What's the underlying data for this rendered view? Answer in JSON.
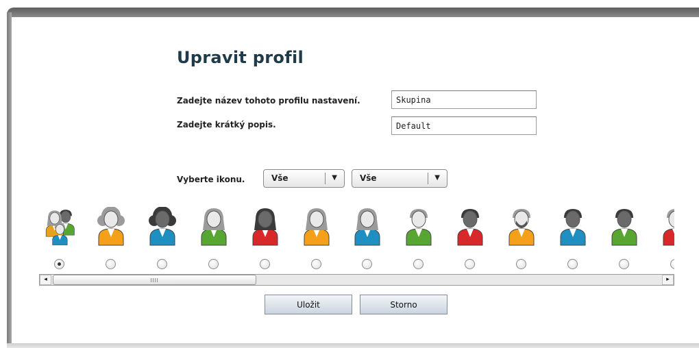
{
  "dialog": {
    "title": "Upravit profil"
  },
  "form": {
    "name_label": "Zadejte název tohoto profilu nastavení.",
    "name_value": "Skupina",
    "description_label": "Zadejte krátký popis.",
    "description_value": "Default"
  },
  "icon_picker": {
    "label": "Vyberte ikonu.",
    "filter1": "Vše",
    "filter2": "Vše",
    "selected_index": 0,
    "icons": [
      {
        "name": "group-icon",
        "type": "group",
        "color": "#e8a31e"
      },
      {
        "name": "user-curly-hair-orange-icon",
        "type": "curly",
        "color": "#f5a019"
      },
      {
        "name": "user-curly-hair-blue-icon",
        "type": "curly-dark",
        "color": "#1f8fc1"
      },
      {
        "name": "user-female-green-icon",
        "type": "female",
        "color": "#57a633"
      },
      {
        "name": "user-female-red-icon",
        "type": "female-dark",
        "color": "#d8282a"
      },
      {
        "name": "user-female-orange-icon",
        "type": "female-light",
        "color": "#f5a019"
      },
      {
        "name": "user-female-blue-icon",
        "type": "female-light",
        "color": "#1f8fc1"
      },
      {
        "name": "user-male-green-icon",
        "type": "male-light",
        "color": "#57a633"
      },
      {
        "name": "user-male-red-icon",
        "type": "male-dark",
        "color": "#d8282a"
      },
      {
        "name": "user-male-bearded-orange-icon",
        "type": "beard",
        "color": "#f5a019"
      },
      {
        "name": "user-male-blue-icon",
        "type": "male-dark",
        "color": "#1f8fc1"
      },
      {
        "name": "user-male-green-icon",
        "type": "male-dark",
        "color": "#57a633"
      },
      {
        "name": "user-male-red-icon",
        "type": "male-light",
        "color": "#d8282a"
      }
    ]
  },
  "scrollbar": {
    "left_arrow": "◂",
    "right_arrow": "▸",
    "position": 0.0,
    "visible_fraction": 0.32
  },
  "actions": {
    "save_label": "Uložit",
    "cancel_label": "Storno"
  }
}
